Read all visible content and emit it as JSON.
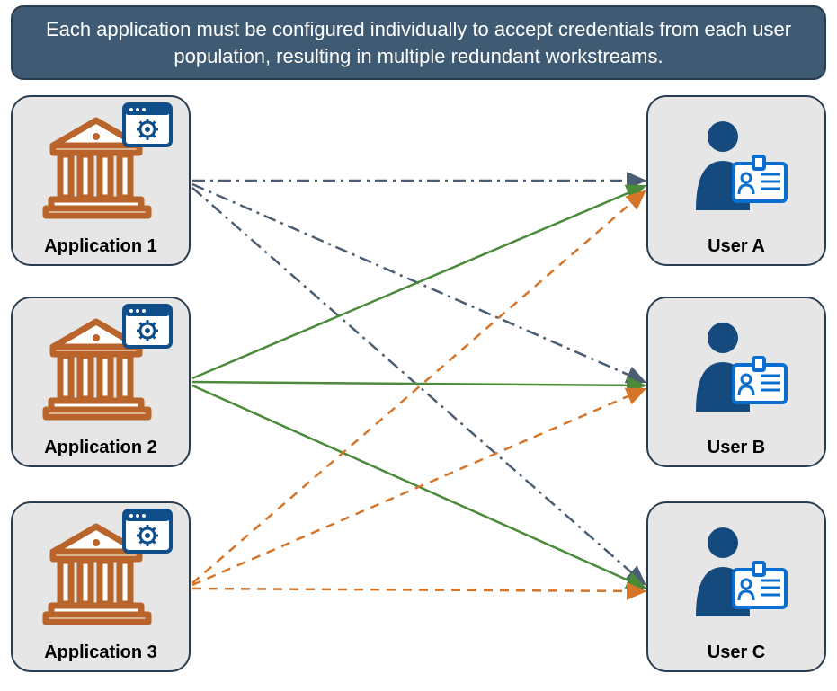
{
  "banner": {
    "text": "Each application must be configured individually to accept credentials from each user population, resulting in multiple redundant workstreams."
  },
  "colors": {
    "banner_bg": "#3f5a73",
    "border": "#2a3d50",
    "box_bg": "#e6e6e6",
    "app_icon": "#b8642b",
    "gear_window": "#0f4e8a",
    "user_icon": "#154a7f",
    "line_dashdot": "#4b5d72",
    "line_solid": "#4a8a3a",
    "line_dash": "#d67528"
  },
  "applications": [
    {
      "label": "Application 1"
    },
    {
      "label": "Application 2"
    },
    {
      "label": "Application 3"
    }
  ],
  "users": [
    {
      "label": "User A"
    },
    {
      "label": "User B"
    },
    {
      "label": "User C"
    }
  ],
  "connections": {
    "description": "Each application connects to every user (bipartite K3,3). Application 1 uses dash-dot navy lines, Application 2 uses solid green lines, Application 3 uses dashed orange lines.",
    "styles": {
      "app1": "dash-dot",
      "app2": "solid",
      "app3": "dashed"
    }
  }
}
